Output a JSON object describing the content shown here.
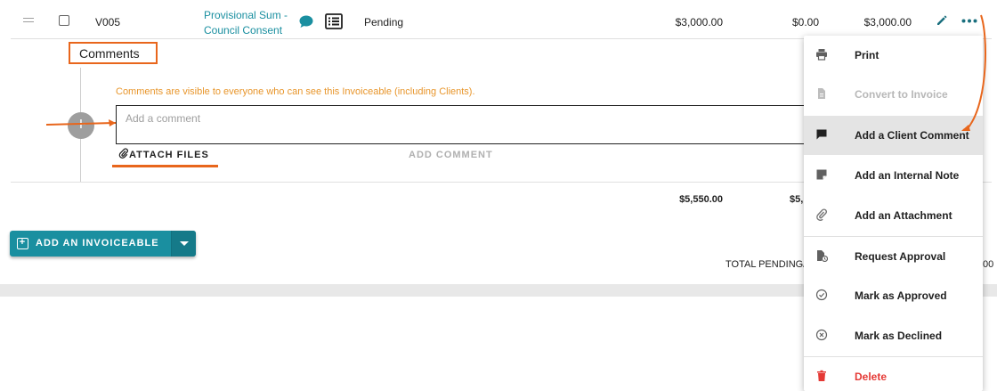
{
  "row": {
    "code": "V005",
    "name_line1": "Provisional Sum -",
    "name_line2": "Council Consent",
    "status": "Pending",
    "amount": "$3,000.00",
    "paid": "$0.00",
    "total": "$3,000.00"
  },
  "comments": {
    "header": "Comments",
    "visibility_note": "Comments are visible to everyone who can see this Invoiceable (including Clients).",
    "input_placeholder": "Add a comment",
    "attach_files_label": "ATTACH FILES",
    "add_comment_label": "ADD COMMENT"
  },
  "summary": {
    "total_amount": "$5,550.00",
    "partial_amount": "$5,",
    "total_pending_label": "TOTAL PENDING/",
    "trailing_value": "00"
  },
  "add_invoiceable": {
    "label": "ADD AN INVOICEABLE"
  },
  "menu": {
    "items": [
      {
        "label": "Print",
        "icon": "printer-icon"
      },
      {
        "label": "Convert to Invoice",
        "icon": "document-icon",
        "disabled": true
      },
      {
        "label": "Add a Client Comment",
        "icon": "comment-icon",
        "highlighted": true
      },
      {
        "label": "Add an Internal Note",
        "icon": "note-icon"
      },
      {
        "label": "Add an Attachment",
        "icon": "paperclip-icon"
      },
      {
        "label": "Request Approval",
        "icon": "request-approval-icon"
      },
      {
        "label": "Mark as Approved",
        "icon": "check-circle-icon"
      },
      {
        "label": "Mark as Declined",
        "icon": "x-circle-icon"
      },
      {
        "label": "Delete",
        "icon": "trash-icon",
        "danger": true
      }
    ]
  },
  "colors": {
    "accent": "#1a8fa0",
    "annotation": "#e8661c",
    "note": "#e8962c",
    "danger": "#e53935"
  }
}
